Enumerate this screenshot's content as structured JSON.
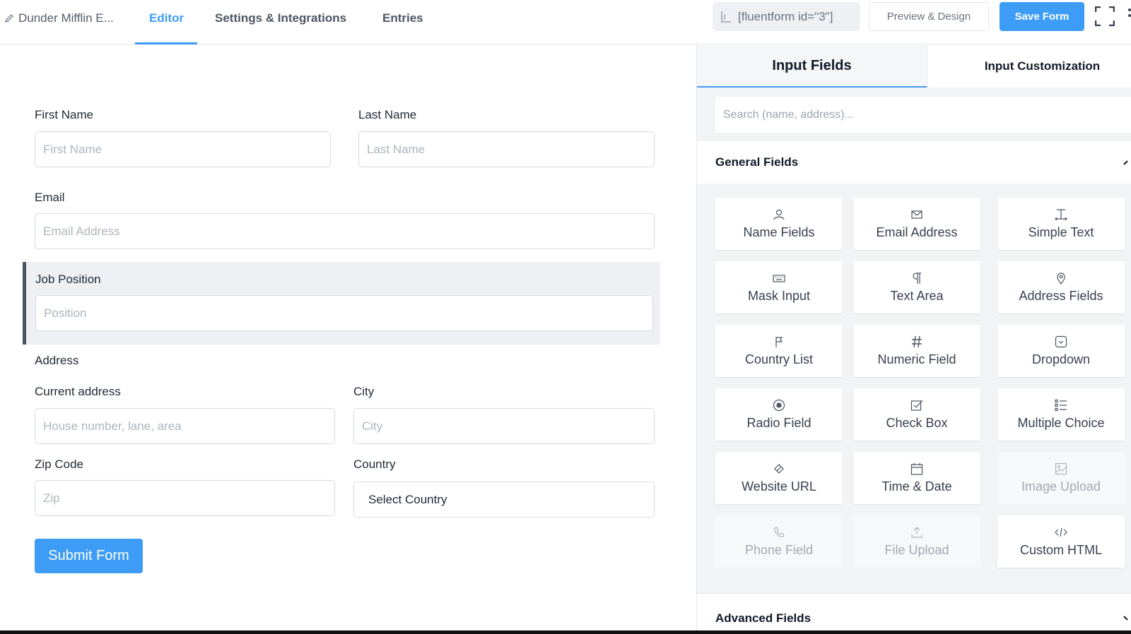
{
  "topbar": {
    "form_name": "Dunder Mifflin E...",
    "tabs": [
      "Editor",
      "Settings & Integrations",
      "Entries"
    ],
    "shortcode": "[fluentform id=\"3\"]",
    "preview_label": "Preview & Design",
    "save_label": "Save Form"
  },
  "form": {
    "first_name_label": "First Name",
    "first_name_placeholder": "First Name",
    "last_name_label": "Last Name",
    "last_name_placeholder": "Last Name",
    "email_label": "Email",
    "email_placeholder": "Email Address",
    "job_label": "Job Position",
    "job_placeholder": "Position",
    "address_section": "Address",
    "current_address_label": "Current address",
    "current_address_placeholder": "House number, lane, area",
    "city_label": "City",
    "city_placeholder": "City",
    "zip_label": "Zip Code",
    "zip_placeholder": "Zip",
    "country_label": "Country",
    "country_value": "Select Country",
    "submit_label": "Submit Form"
  },
  "panel": {
    "tab_inputs": "Input Fields",
    "tab_customization": "Input Customization",
    "search_placeholder": "Search (name, address)...",
    "general_title": "General Fields",
    "advanced_title": "Advanced Fields",
    "fields": [
      {
        "label": "Name Fields",
        "icon": "user-icon",
        "disabled": false
      },
      {
        "label": "Email Address",
        "icon": "envelope-icon",
        "disabled": false
      },
      {
        "label": "Simple Text",
        "icon": "text-cursor-icon",
        "disabled": false
      },
      {
        "label": "Mask Input",
        "icon": "keyboard-icon",
        "disabled": false
      },
      {
        "label": "Text Area",
        "icon": "paragraph-icon",
        "disabled": false
      },
      {
        "label": "Address Fields",
        "icon": "map-pin-icon",
        "disabled": false
      },
      {
        "label": "Country List",
        "icon": "flag-icon",
        "disabled": false
      },
      {
        "label": "Numeric Field",
        "icon": "hash-icon",
        "disabled": false
      },
      {
        "label": "Dropdown",
        "icon": "dropdown-icon",
        "disabled": false
      },
      {
        "label": "Radio Field",
        "icon": "radio-icon",
        "disabled": false
      },
      {
        "label": "Check Box",
        "icon": "checkbox-icon",
        "disabled": false
      },
      {
        "label": "Multiple Choice",
        "icon": "list-icon",
        "disabled": false
      },
      {
        "label": "Website URL",
        "icon": "link-icon",
        "disabled": false
      },
      {
        "label": "Time & Date",
        "icon": "calendar-icon",
        "disabled": false
      },
      {
        "label": "Image Upload",
        "icon": "image-icon",
        "disabled": true
      },
      {
        "label": "Phone Field",
        "icon": "phone-icon",
        "disabled": true
      },
      {
        "label": "File Upload",
        "icon": "upload-icon",
        "disabled": true
      },
      {
        "label": "Custom HTML",
        "icon": "code-icon",
        "disabled": false
      }
    ]
  },
  "colors": {
    "accent": "#3d9cf5",
    "panel_bg": "#f1f3f5"
  }
}
